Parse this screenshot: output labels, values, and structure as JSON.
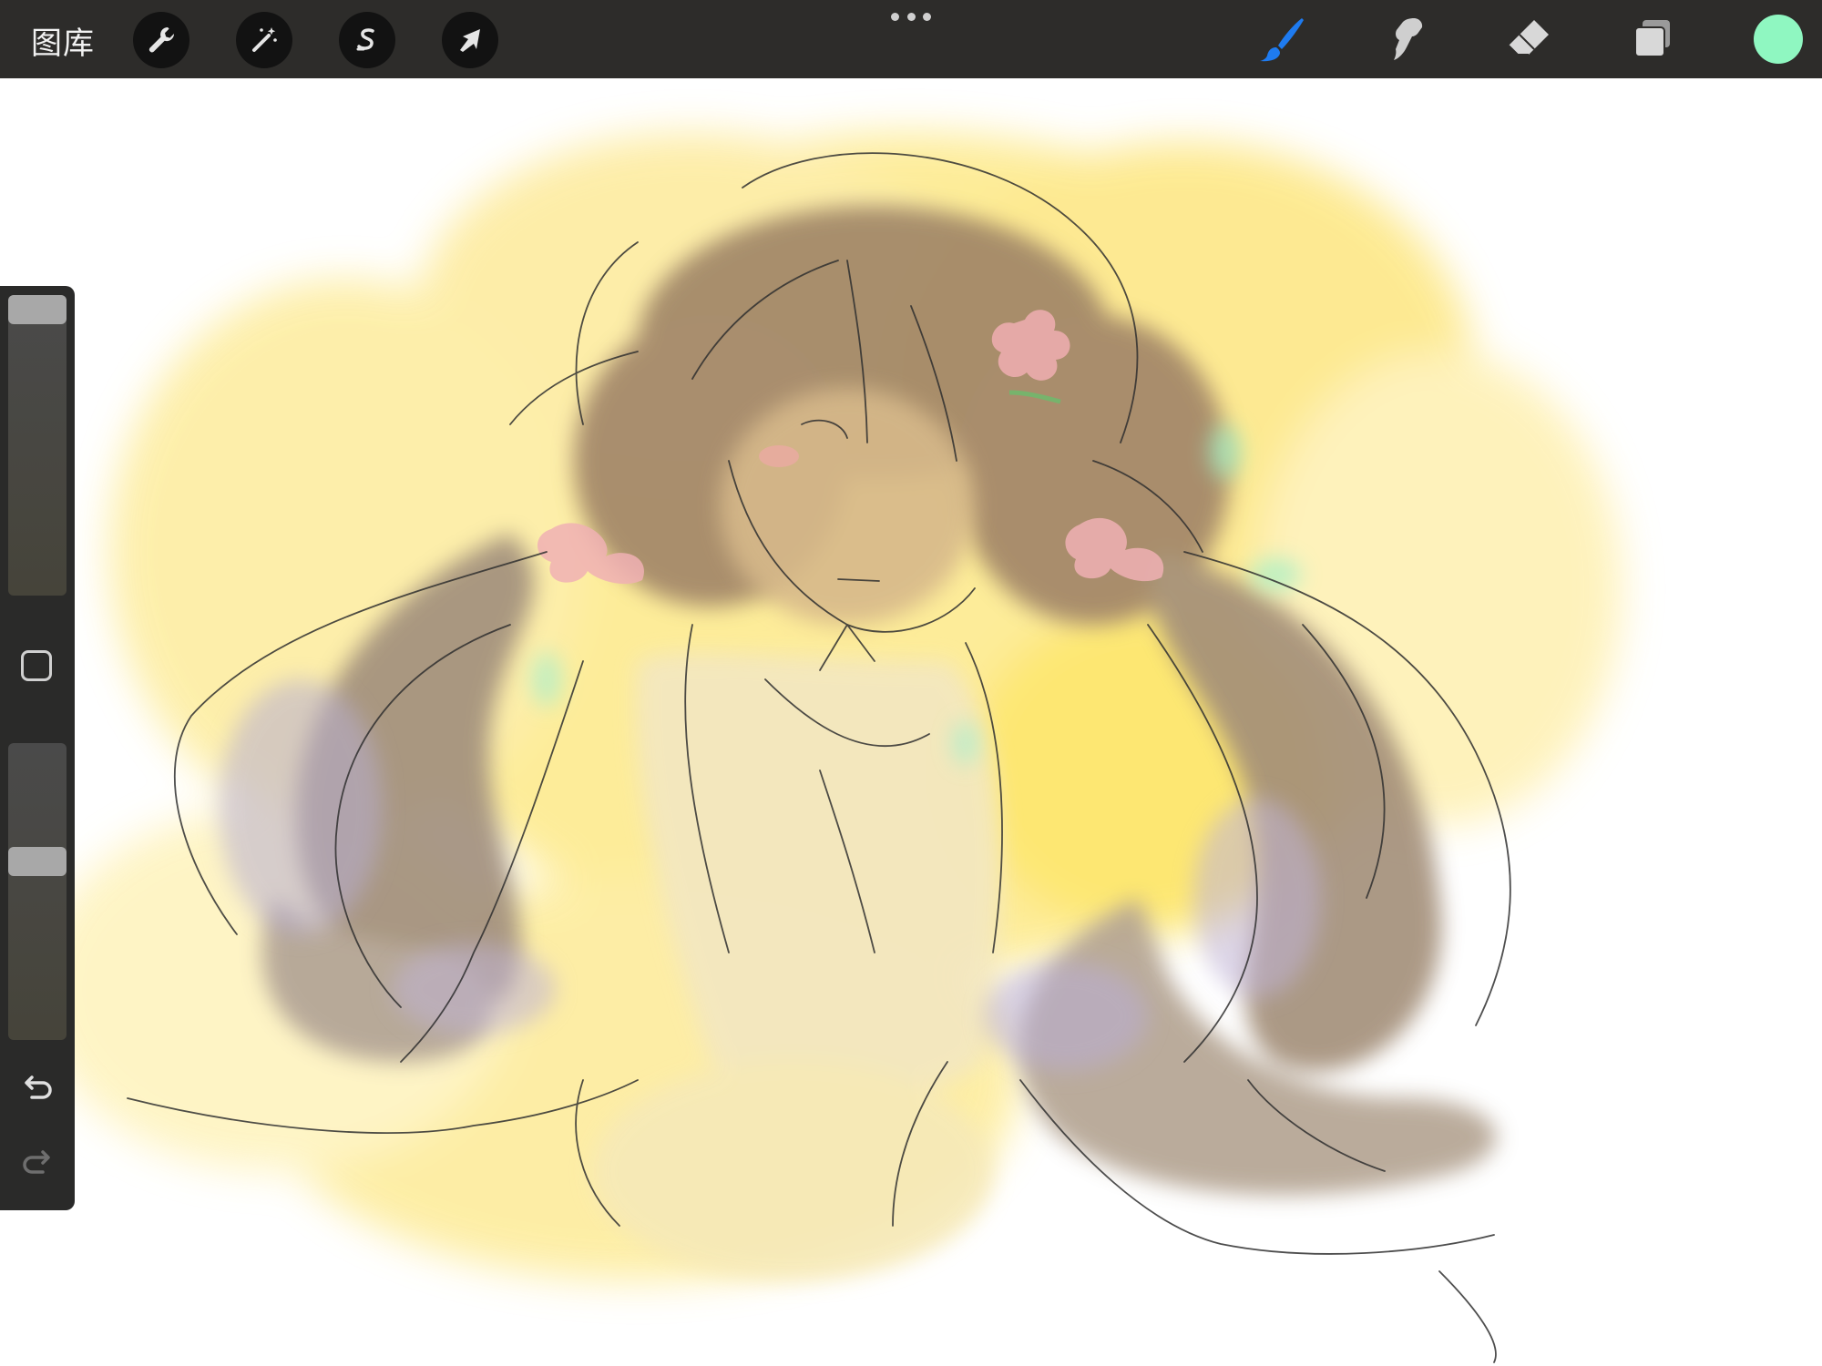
{
  "toolbar": {
    "gallery_label": "图库",
    "left_tools": [
      "wrench-icon",
      "magic-wand-icon",
      "selection-s-icon",
      "transform-arrow-icon"
    ],
    "right_tools": [
      "brush-icon",
      "smudge-icon",
      "eraser-icon",
      "layers-icon"
    ],
    "active_tool": "brush-icon",
    "accent_color": "#1e7bf0",
    "current_color": "#8ff7c1"
  },
  "sidebar": {
    "brush_size_level": 0.02,
    "opacity_level": 0.35,
    "buttons": [
      "modify-square-icon",
      "undo-icon",
      "redo-icon"
    ]
  },
  "canvas": {
    "colors": {
      "background": "#fffbe0",
      "yellow_wash": "#fde878",
      "hair_brown": "#9a7f68",
      "skin": "#e8d6a8",
      "flower_pink": "#f0aeb2",
      "lavender": "#b7aed0",
      "mint": "#9ff0c7",
      "sketch_line": "#2f2f2f"
    }
  }
}
